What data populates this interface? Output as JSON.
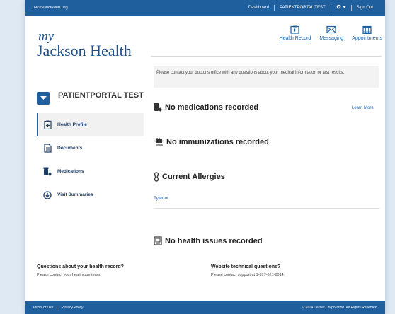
{
  "topbar": {
    "site": "JacksonHealth.org",
    "links": [
      "Dashboard",
      "PATIENTPORTAL TEST",
      "Sign Out"
    ]
  },
  "logo": {
    "my": "my",
    "name": "Jackson Health"
  },
  "nav": [
    {
      "label": "Health Record",
      "icon": "health-record-icon",
      "active": true
    },
    {
      "label": "Messaging",
      "icon": "envelope-icon"
    },
    {
      "label": "Appointments",
      "icon": "calendar-icon"
    }
  ],
  "patient": {
    "name": "PATIENTPORTAL TEST"
  },
  "sidebar": {
    "items": [
      {
        "label": "Health Profile",
        "icon": "health-profile-icon",
        "active": true
      },
      {
        "label": "Documents",
        "icon": "document-icon"
      },
      {
        "label": "Medications",
        "icon": "pill-bottle-icon"
      },
      {
        "label": "Visit Summaries",
        "icon": "circle-arrow-icon"
      }
    ]
  },
  "main": {
    "notice": "Please contact your doctor's office with any questions about your medical information or test results.",
    "medications": "No medications recorded",
    "learn_more": "Learn More",
    "immunizations": "No immunizations recorded",
    "allergies_title": "Current Allergies",
    "allergy_item": "Tylenol",
    "health_issues": "No health issues recorded"
  },
  "footer": {
    "q1_title": "Questions about your health record?",
    "q1_text": "Please contact your healthcare team.",
    "q2_title": "Website technical questions?",
    "q2_text": "Please contact support at 1-877-621-8014.",
    "links": [
      "Terms of Use",
      "Privacy Policy"
    ],
    "copyright": "© 2014 Cerner Corporation. All Rights Reserved."
  },
  "colors": {
    "brand": "#1f5f9e",
    "link": "#2a6ab2"
  }
}
